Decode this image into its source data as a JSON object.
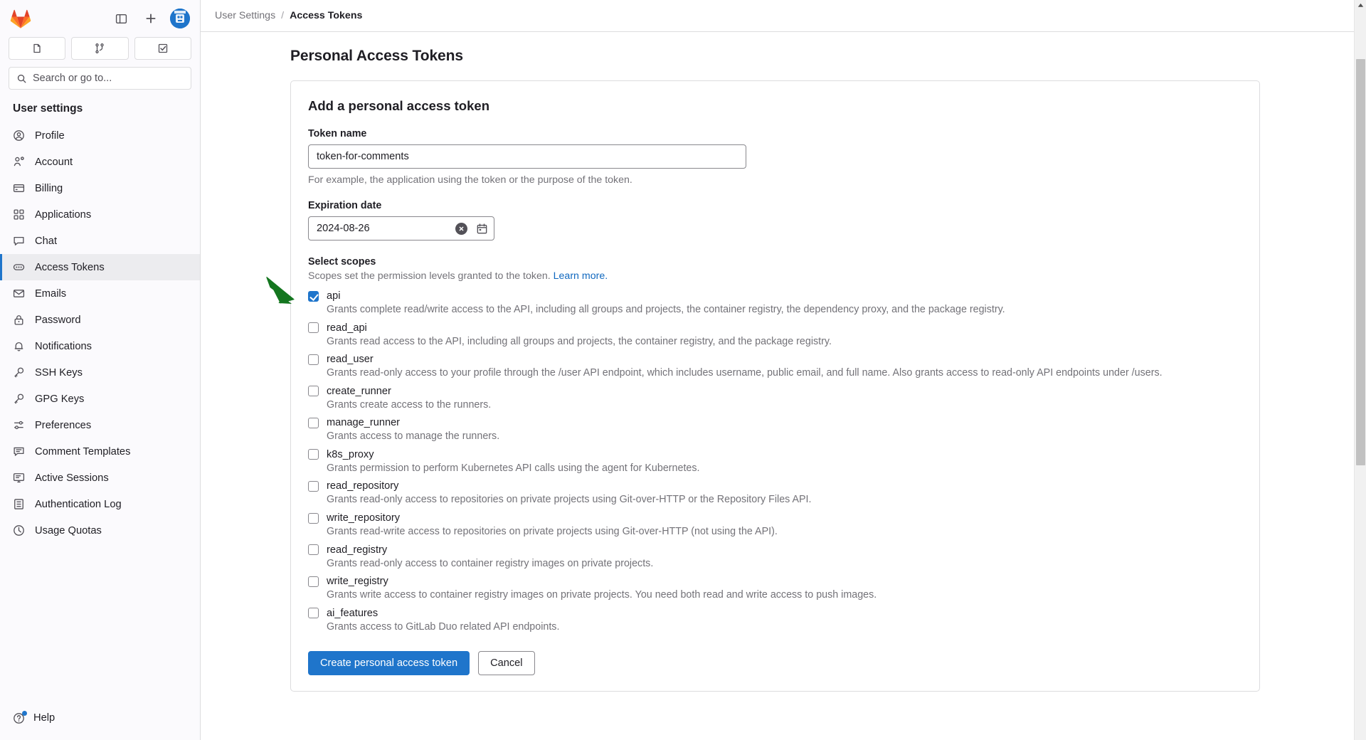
{
  "topbar": {
    "logo_icon": "gitlab-logo-icon",
    "sidebar_toggle_icon": "panel-toggle-icon",
    "new_icon": "plus-icon",
    "avatar_icon": "user-avatar"
  },
  "quick_actions": [
    {
      "icon": "issues-icon",
      "name": "quick-action-issues"
    },
    {
      "icon": "merge-request-icon",
      "name": "quick-action-merge-requests"
    },
    {
      "icon": "todos-icon",
      "name": "quick-action-todos"
    }
  ],
  "search": {
    "placeholder": "Search or go to...",
    "icon": "search-icon"
  },
  "sidebar": {
    "section_title": "User settings",
    "items": [
      {
        "label": "Profile",
        "icon": "user-circle-icon",
        "active": false
      },
      {
        "label": "Account",
        "icon": "account-gear-icon",
        "active": false
      },
      {
        "label": "Billing",
        "icon": "credit-card-icon",
        "active": false
      },
      {
        "label": "Applications",
        "icon": "applications-grid-icon",
        "active": false
      },
      {
        "label": "Chat",
        "icon": "chat-bubble-icon",
        "active": false
      },
      {
        "label": "Access Tokens",
        "icon": "token-icon",
        "active": true
      },
      {
        "label": "Emails",
        "icon": "envelope-icon",
        "active": false
      },
      {
        "label": "Password",
        "icon": "lock-icon",
        "active": false
      },
      {
        "label": "Notifications",
        "icon": "bell-icon",
        "active": false
      },
      {
        "label": "SSH Keys",
        "icon": "key-icon",
        "active": false
      },
      {
        "label": "GPG Keys",
        "icon": "key-icon",
        "active": false
      },
      {
        "label": "Preferences",
        "icon": "sliders-icon",
        "active": false
      },
      {
        "label": "Comment Templates",
        "icon": "comment-lines-icon",
        "active": false
      },
      {
        "label": "Active Sessions",
        "icon": "monitor-icon",
        "active": false
      },
      {
        "label": "Authentication Log",
        "icon": "log-list-icon",
        "active": false
      },
      {
        "label": "Usage Quotas",
        "icon": "quota-gauge-icon",
        "active": false
      }
    ],
    "help": {
      "label": "Help",
      "icon": "question-circle-icon",
      "badge": true
    }
  },
  "breadcrumb": {
    "parent": "User Settings",
    "separator": "/",
    "current": "Access Tokens"
  },
  "page": {
    "title": "Personal Access Tokens"
  },
  "form": {
    "card_title": "Add a personal access token",
    "token_name": {
      "label": "Token name",
      "value": "token-for-comments",
      "placeholder": "",
      "help": "For example, the application using the token or the purpose of the token."
    },
    "expiration_date": {
      "label": "Expiration date",
      "value": "2024-08-26",
      "clear_icon": "clear-circle-x-icon",
      "calendar_icon": "calendar-icon"
    },
    "scopes": {
      "label": "Select scopes",
      "description": "Scopes set the permission levels granted to the token.",
      "learn_more": "Learn more.",
      "items": [
        {
          "name": "api",
          "checked": true,
          "description": "Grants complete read/write access to the API, including all groups and projects, the container registry, the dependency proxy, and the package registry."
        },
        {
          "name": "read_api",
          "checked": false,
          "description": "Grants read access to the API, including all groups and projects, the container registry, and the package registry."
        },
        {
          "name": "read_user",
          "checked": false,
          "description": "Grants read-only access to your profile through the /user API endpoint, which includes username, public email, and full name. Also grants access to read-only API endpoints under /users."
        },
        {
          "name": "create_runner",
          "checked": false,
          "description": "Grants create access to the runners."
        },
        {
          "name": "manage_runner",
          "checked": false,
          "description": "Grants access to manage the runners."
        },
        {
          "name": "k8s_proxy",
          "checked": false,
          "description": "Grants permission to perform Kubernetes API calls using the agent for Kubernetes."
        },
        {
          "name": "read_repository",
          "checked": false,
          "description": "Grants read-only access to repositories on private projects using Git-over-HTTP or the Repository Files API."
        },
        {
          "name": "write_repository",
          "checked": false,
          "description": "Grants read-write access to repositories on private projects using Git-over-HTTP (not using the API)."
        },
        {
          "name": "read_registry",
          "checked": false,
          "description": "Grants read-only access to container registry images on private projects."
        },
        {
          "name": "write_registry",
          "checked": false,
          "description": "Grants write access to container registry images on private projects. You need both read and write access to push images."
        },
        {
          "name": "ai_features",
          "checked": false,
          "description": "Grants access to GitLab Duo related API endpoints."
        }
      ]
    },
    "submit_label": "Create personal access token",
    "cancel_label": "Cancel"
  },
  "annotation": {
    "arrow_color": "#14761f",
    "points_at": "api-scope-checkbox"
  },
  "colors": {
    "accent": "#1f75cb",
    "link": "#1068bf",
    "text": "#1f1e24",
    "muted": "#737278",
    "border": "#dcdcde",
    "sidebar_bg": "#fbfafd",
    "active_bg": "#ececef"
  },
  "scrollbar": {
    "up_arrow_icon": "scroll-up-arrow-icon"
  }
}
